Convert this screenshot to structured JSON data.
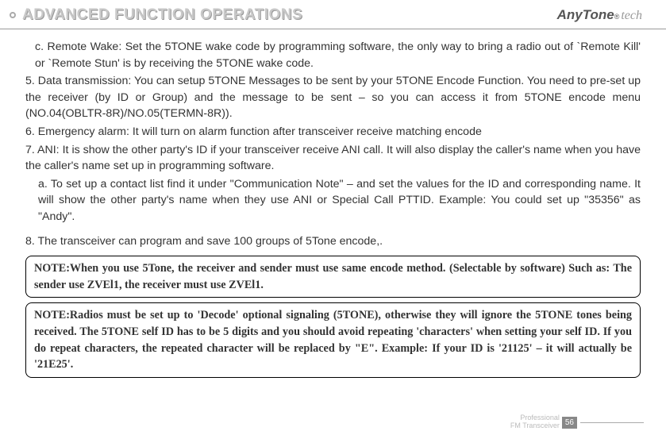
{
  "header": {
    "title": "ADVANCED FUNCTION OPERATIONS",
    "brand_main": "AnyTone",
    "brand_sub": "tech"
  },
  "body": {
    "item_c": "c. Remote Wake: Set the 5TONE wake code by programming software, the only way to bring a radio out of `Remote Kill' or `Remote Stun' is by receiving the 5TONE wake code.",
    "item_5": "5. Data transmission: You can setup 5TONE Messages to be sent by your 5TONE Encode Function. You need to pre-set up the receiver (by ID or Group) and the message to be sent – so you can access it from 5TONE encode menu (NO.04(OBLTR-8R)/NO.05(TERMN-8R)).",
    "item_6": "6.  Emergency alarm: It will turn on alarm function after transceiver receive matching encode",
    "item_7": "7. ANI: It is show the other party's ID if your transceiver receive ANI call. It will also display the caller's name when you have the caller's name set up in programming software.",
    "item_a": "a. To set up a contact list find it under \"Communication Note\" – and set the values for the ID and corresponding name. It will show the other party's name when they use ANI or Special Call PTTID. Example: You could set up \"35356\" as \"Andy\".",
    "item_8": "8. The transceiver can program and save 100 groups of 5Tone encode,.",
    "note1": "NOTE:When you use 5Tone, the receiver and sender must use same encode method. (Selectable by software) Such as: The sender use ZVEl1, the receiver must use ZVEl1.",
    "note2": "NOTE:Radios must be set up to 'Decode' optional signaling (5TONE), otherwise they will ignore the 5TONE tones being received. The 5TONE self ID has to be 5 digits and you should avoid repeating 'characters' when setting your self ID. If you do repeat characters, the repeated character will be replaced by \"E\". Example: If your ID is  '21125' – it will actually be '21E25'."
  },
  "footer": {
    "line1": "Professional",
    "line2": "FM Transceiver",
    "page": "56"
  }
}
